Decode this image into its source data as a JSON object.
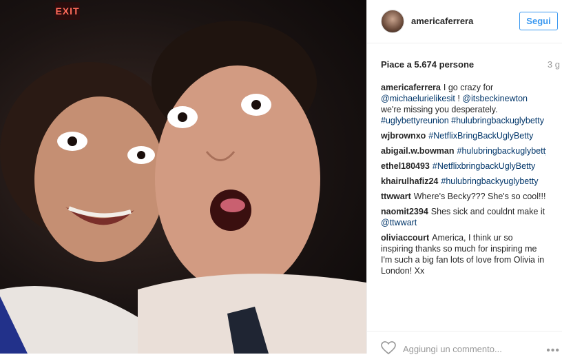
{
  "photo": {
    "exit_sign": "EXIT"
  },
  "header": {
    "username": "americaferrera",
    "follow_label": "Segui"
  },
  "post": {
    "likes": "Piace a 5.674 persone",
    "age": "3 g"
  },
  "comments": [
    {
      "user": "americaferrera",
      "parts": [
        {
          "t": "I go crazy for "
        },
        {
          "t": "@michaelurielikesit",
          "tag": true
        },
        {
          "t": " ! "
        },
        {
          "t": "@itsbeckinewton",
          "tag": true
        },
        {
          "t": " we're missing you desperately. "
        },
        {
          "t": "#uglybettyreunion",
          "tag": true
        },
        {
          "t": " "
        },
        {
          "t": "#hulubringbackuglybetty",
          "tag": true
        }
      ]
    },
    {
      "user": "wjbrownxo",
      "parts": [
        {
          "t": "#NetflixBringBackUglyBetty",
          "tag": true
        }
      ]
    },
    {
      "user": "abigail.w.bowman",
      "parts": [
        {
          "t": "#hulubringbackuglybetty",
          "tag": true
        }
      ]
    },
    {
      "user": "ethel180493",
      "parts": [
        {
          "t": "#NetflixbringbackUglyBetty",
          "tag": true
        }
      ]
    },
    {
      "user": "khairulhafiz24",
      "parts": [
        {
          "t": "#hulubringbackyuglybetty",
          "tag": true
        }
      ]
    },
    {
      "user": "ttwwart",
      "parts": [
        {
          "t": "Where's Becky??? She's so cool!!!"
        }
      ]
    },
    {
      "user": "naomit2394",
      "parts": [
        {
          "t": "Shes sick and couldnt make it "
        },
        {
          "t": "@ttwwart",
          "tag": true
        }
      ]
    },
    {
      "user": "oliviaccourt",
      "parts": [
        {
          "t": "America, I think ur so inspiring thanks so much for inspiring me I'm such a big fan lots of love from Olivia in London! Xx"
        }
      ]
    }
  ],
  "footer": {
    "add_comment_placeholder": "Aggiungi un commento...",
    "more_label": "•••"
  },
  "icons": {
    "like": "heart-icon",
    "more": "more-options-icon"
  }
}
